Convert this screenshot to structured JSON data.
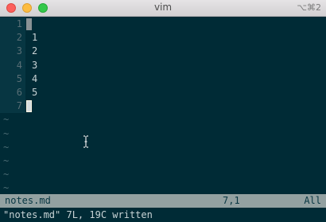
{
  "window": {
    "title": "vim",
    "shortcut": "⌥⌘2"
  },
  "buffer": {
    "lines": [
      {
        "number": "1",
        "text": ""
      },
      {
        "number": "2",
        "text": "1"
      },
      {
        "number": "3",
        "text": "2"
      },
      {
        "number": "4",
        "text": "3"
      },
      {
        "number": "5",
        "text": "4"
      },
      {
        "number": "6",
        "text": "5"
      },
      {
        "number": "7",
        "text": ""
      }
    ],
    "tilde": "~"
  },
  "status": {
    "filename": "notes.md",
    "position": "7,1",
    "scroll": "All"
  },
  "command_line": "\"notes.md\" 7L, 19C written",
  "colors": {
    "background": "#002b36",
    "gutter": "#073642",
    "statusline": "#93a1a1"
  }
}
